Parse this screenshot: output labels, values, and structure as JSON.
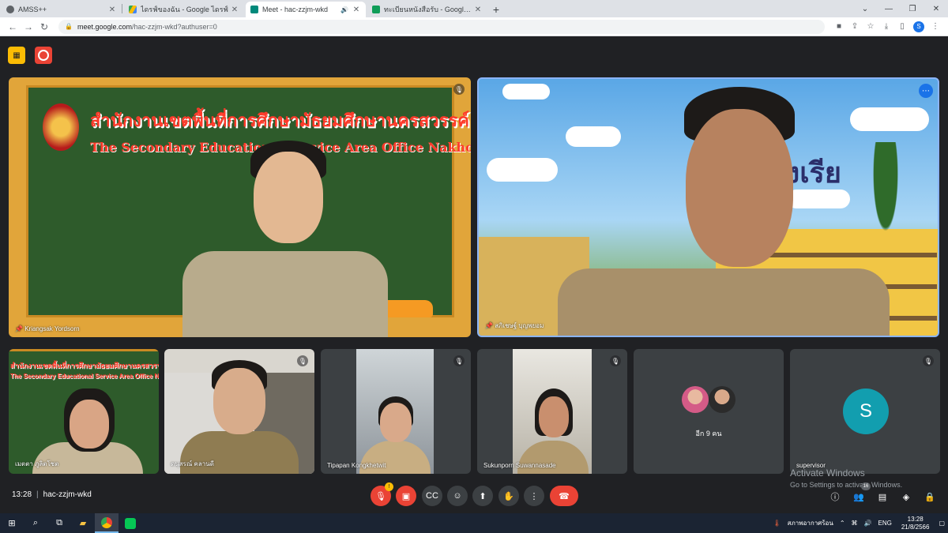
{
  "browser": {
    "tabs": [
      {
        "title": "AMSS++",
        "icon": "globe-icon",
        "active": false,
        "color": "#5f6368"
      },
      {
        "title": "ไดรฟ์ของฉัน - Google ไดรฟ์",
        "icon": "google-drive-icon",
        "active": false,
        "color": "#34a853"
      },
      {
        "title": "Meet - hac-zzjm-wkd",
        "icon": "google-meet-icon",
        "active": true,
        "color": "#00897b"
      },
      {
        "title": "ทะเบียนหนังสือรับ - Google ชีต",
        "icon": "google-sheets-icon",
        "active": false,
        "color": "#0f9d58"
      }
    ],
    "url_host": "meet.google.com",
    "url_path": "/hac-zzjm-wkd?authuser=0",
    "profile_initial": "S"
  },
  "meet": {
    "main_tiles": [
      {
        "name": "Kriangsak Yordsorn",
        "board_title_th": "สำนักงานเขตพื้นที่การศึกษามัธยมศึกษานครสวรรค์",
        "board_title_en": "The Secondary Educational Service Area Office Nakhon Sawan"
      },
      {
        "name": "สภิเชษฐ์ บุญพยอม"
      }
    ],
    "small_tiles": [
      {
        "name": "เมตตา ภูลิตโชต",
        "board_th": "สำนักงานเขตพื้นที่การศึกษามัธยมศึกษานครสวรรค์",
        "board_en": "The Secondary Educational Service Area Office Nakhon"
      },
      {
        "name": "ดนุสรณ์ คลานดี"
      },
      {
        "name": "Tipapan Kongkhetwit"
      },
      {
        "name": "Sukunporn Suwannasade"
      },
      {
        "name": "อีก 9 คน"
      },
      {
        "name": "supervisor",
        "initial": "S"
      }
    ],
    "watermark": {
      "line1": "Activate Windows",
      "line2": "Go to Settings to activate Windows."
    },
    "time": "13:28",
    "meeting_code": "hac-zzjm-wkd",
    "controls": {
      "mic_badge": "!",
      "people_count": "16"
    },
    "colors": {
      "accent": "#1a73e8",
      "danger": "#ea4335",
      "warning": "#fbbc04",
      "avatar": "#129eaf"
    }
  },
  "taskbar": {
    "weather": "สภาพอากาศร้อน",
    "lang": "ENG",
    "time": "13:28",
    "date": "21/8/2566"
  }
}
